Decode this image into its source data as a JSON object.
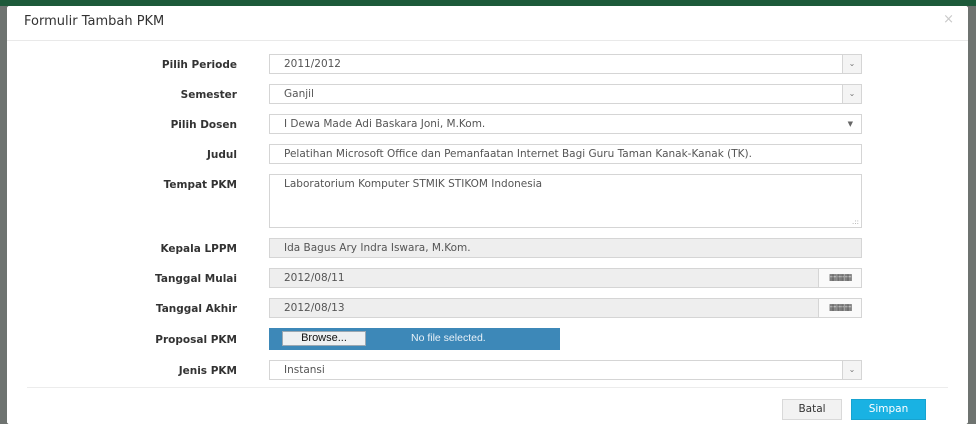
{
  "modal": {
    "title": "Formulir Tambah PKM",
    "close_symbol": "×"
  },
  "form": {
    "periode": {
      "label": "Pilih Periode",
      "value": "2011/2012"
    },
    "semester": {
      "label": "Semester",
      "value": "Ganjil"
    },
    "dosen": {
      "label": "Pilih Dosen",
      "value": "I Dewa Made Adi Baskara Joni, M.Kom."
    },
    "judul": {
      "label": "Judul",
      "value": "Pelatihan Microsoft Office dan Pemanfaatan Internet Bagi Guru Taman Kanak-Kanak (TK)."
    },
    "tempat": {
      "label": "Tempat PKM",
      "value": "Laboratorium Komputer STMIK STIKOM Indonesia"
    },
    "kepala": {
      "label": "Kepala LPPM",
      "value": "Ida Bagus Ary Indra Iswara, M.Kom."
    },
    "tanggal_mulai": {
      "label": "Tanggal Mulai",
      "value": "2012/08/11"
    },
    "tanggal_akhir": {
      "label": "Tanggal Akhir",
      "value": "2012/08/13"
    },
    "proposal": {
      "label": "Proposal PKM",
      "browse_label": "Browse...",
      "status": "No file selected."
    },
    "jenis": {
      "label": "Jenis PKM",
      "value": "Instansi"
    }
  },
  "footer": {
    "cancel_label": "Batal",
    "save_label": "Simpan"
  },
  "icons": {
    "select_arrow": "chevron-down-icon",
    "calendar": "calendar-icon"
  },
  "colors": {
    "primary": "#19b2e3",
    "file_input": "#3d88b8",
    "readonly_bg": "#eeeeee"
  }
}
